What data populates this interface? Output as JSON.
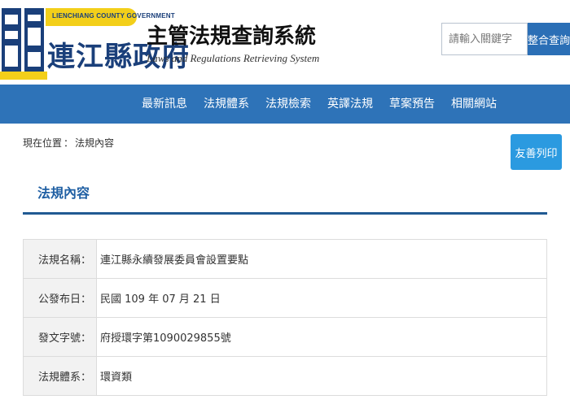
{
  "header": {
    "logo_band_text": "LIENCHIANG COUNTY GOVERNMENT",
    "logo_title": "連江縣政府",
    "system_title": "主管法規查詢系統",
    "system_subtitle": "Laws and Regulations Retrieving System",
    "search_placeholder": "請輸入關鍵字",
    "search_button": "整合查詢"
  },
  "nav": {
    "items": [
      "最新訊息",
      "法規體系",
      "法規檢索",
      "英譯法規",
      "草案預告",
      "相關網站"
    ]
  },
  "breadcrumb": {
    "prefix": "現在位置",
    "separator": "：",
    "current": "法規內容"
  },
  "print_button": "友善列印",
  "section_title": "法規內容",
  "details": [
    {
      "label": "法規名稱：",
      "value": "連江縣永續發展委員會設置要點"
    },
    {
      "label": "公發布日：",
      "value": "民國 109 年 07 月 21 日"
    },
    {
      "label": "發文字號：",
      "value": "府授環字第1090029855號"
    },
    {
      "label": "法規體系：",
      "value": "環資類"
    }
  ],
  "colors": {
    "nav_bg": "#2e73b8",
    "brand_blue": "#1a3f7a",
    "logo_yellow": "#f3cf1a",
    "print_btn": "#2b9ae0",
    "section_title": "#1f5fa3"
  }
}
